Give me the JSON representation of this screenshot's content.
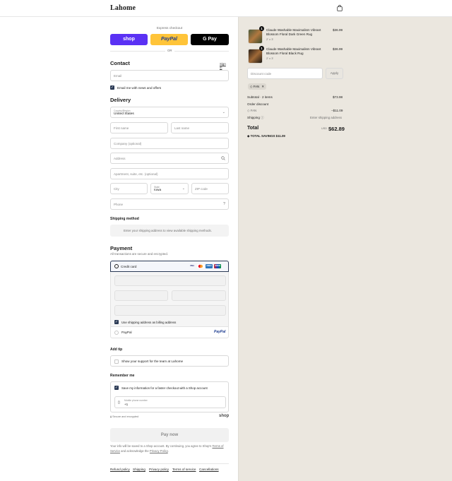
{
  "header": {
    "brand": "Lahome",
    "cart_icon": "shopping-bag-icon"
  },
  "express": {
    "title": "Express checkout",
    "shop_label": "shop",
    "paypal_label": "PayPal",
    "gpay_label": "G Pay",
    "or_label": "OR",
    "colors": {
      "shop": "#5a31f4",
      "paypal": "#ffc439",
      "gpay": "#000000"
    }
  },
  "contact": {
    "title": "Contact",
    "sign_in": "Sign in",
    "email_placeholder": "Email",
    "news_label": "Email me with news and offers"
  },
  "delivery": {
    "title": "Delivery",
    "country_label": "Country/Region",
    "country_value": "United States",
    "first_name": "First name",
    "last_name": "Last name",
    "company": "Company (optional)",
    "address": "Address",
    "apartment": "Apartment, suite, etc. (optional)",
    "city": "City",
    "state_label": "State",
    "state_value": "Iowa",
    "zip": "ZIP code",
    "phone": "Phone"
  },
  "shipping": {
    "title": "Shipping method",
    "message": "Enter your shipping address to view available shipping methods."
  },
  "payment": {
    "title": "Payment",
    "subtitle": "All transactions are secure and encrypted.",
    "credit_card_label": "Credit card",
    "cards": [
      "VISA",
      "MC",
      "AMEX",
      "UNION"
    ],
    "billing_label": "Use shipping address as billing address",
    "paypal_label": "PayPal",
    "paypal_logo": "PayPal"
  },
  "tip": {
    "title": "Add tip",
    "label": "Show your support for the team at Lahome"
  },
  "remember": {
    "title": "Remember me",
    "save_label": "Save my information for a faster checkout with a Shop account",
    "phone_label": "Mobile phone number",
    "phone_value": "+1",
    "secure_label": "Secure and encrypted",
    "shop_logo": "shop"
  },
  "pay_now": "Pay now",
  "legal": {
    "text_before": "Your info will be saved to a Shop account. By continuing, you agree to Shop's",
    "terms": "Terms of Service",
    "and_ack": "and acknowledge the",
    "privacy": "Privacy Policy",
    "period": "."
  },
  "footer": [
    "Refund policy",
    "Shipping",
    "Privacy policy",
    "Terms of service",
    "Cancellations"
  ],
  "cart": {
    "items": [
      {
        "name": "Claude Washable Maximalism Vibrant Blossom Floral Dark Green Rug",
        "variant": "2' x 3'",
        "price": "$36.99",
        "qty": "1"
      },
      {
        "name": "Claude Washable Maximalism Vibrant Blossom Floral Black Rug",
        "variant": "2' x 3'",
        "price": "$36.99",
        "qty": "1"
      }
    ],
    "discount_placeholder": "Discount code",
    "apply": "Apply",
    "code_tag": "FAN",
    "subtotal_label": "Subtotal · 2 items",
    "subtotal_value": "$73.98",
    "order_discount_label": "Order discount",
    "discount_code": "FAN",
    "discount_value": "−$11.09",
    "shipping_label": "Shipping",
    "shipping_value": "Enter shipping address",
    "total_label": "Total",
    "currency": "USD",
    "total_value": "$62.89",
    "savings_label": "TOTAL SAVINGS",
    "savings_value": "$11.09"
  }
}
